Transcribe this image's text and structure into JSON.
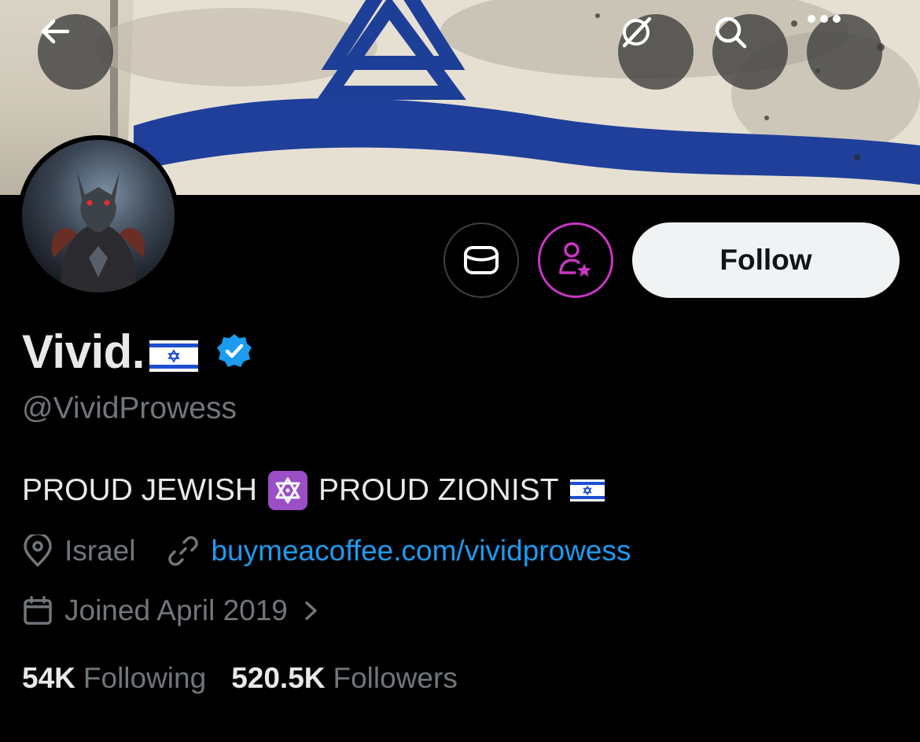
{
  "profile": {
    "display_name": "Vivid.",
    "name_flag": "israel-flag",
    "handle": "@VividProwess",
    "verified_badge": "verified-badge-icon",
    "bio": {
      "part1": "PROUD JEWISH",
      "emoji": "star-of-david-emoji",
      "part2": "PROUD ZIONIST",
      "trailing_flag": "israel-flag"
    },
    "location": "Israel",
    "website": "buymeacoffee.com/vividprowess",
    "joined": "Joined April 2019",
    "stats": {
      "following_count": "54K",
      "following_label": "Following",
      "followers_count": "520.5K",
      "followers_label": "Followers"
    }
  },
  "actions": {
    "follow_label": "Follow",
    "message_icon": "envelope-icon",
    "subscribe_icon": "subscribe-user-star-icon"
  },
  "nav": {
    "back_icon": "back-arrow-icon",
    "grok_icon": "grok-icon",
    "search_icon": "search-icon",
    "more_icon": "more-dots-icon"
  },
  "colors": {
    "background": "#000000",
    "accent_link": "#1d9bf0",
    "verified": "#1d9bf0",
    "subscribe_ring": "#c837c4",
    "secondary_text": "#71767b",
    "follow_button_bg": "#eff3f4",
    "flag_blue": "#1f4fd1"
  }
}
